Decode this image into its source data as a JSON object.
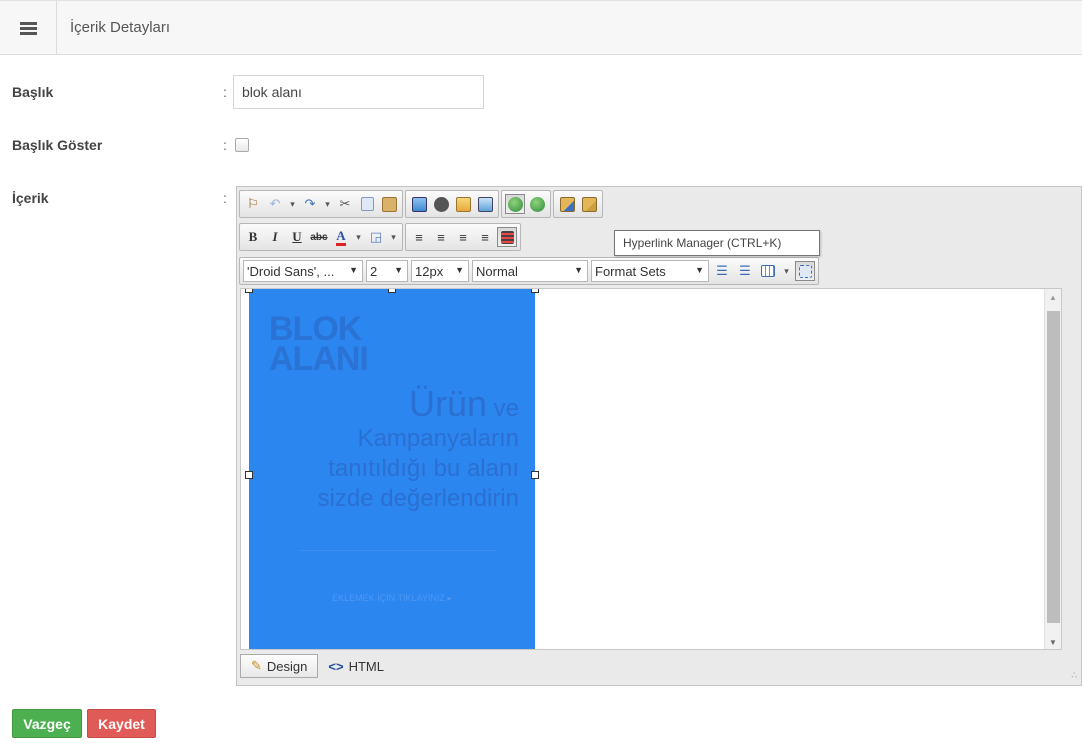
{
  "header": {
    "title": "İçerik Detayları",
    "menu_icon": "hamburger-icon"
  },
  "form": {
    "title_label": "Başlık",
    "title_value": "blok alanı",
    "show_title_label": "Başlık Göster",
    "show_title_checked": false,
    "content_label": "İçerik",
    "colon": ":"
  },
  "editor": {
    "format_bar": {
      "font_family": "'Droid Sans', ...",
      "font_size": "2",
      "pixel_size": "12px",
      "paragraph": "Normal",
      "format_sets": "Format Sets"
    },
    "tooltip": "Hyperlink Manager (CTRL+K)",
    "content_image": {
      "logo_line1": "BLOK",
      "logo_line2": "ALANI",
      "text_line1_big": "Ürün",
      "text_line1_small": " ve",
      "text_line2": "Kampanyaların",
      "text_line3": "tanıtıldığı bu alanı",
      "text_line4": "sizde değerlendirin",
      "cta": "EKLEMEK İÇİN TIKLAYINIZ ▸",
      "background_color": "#2b86f0"
    },
    "modes": {
      "design": "Design",
      "html": "HTML"
    }
  },
  "actions": {
    "cancel": "Vazgeç",
    "save": "Kaydet",
    "cancel_color": "#4caf50",
    "save_color": "#e05a57"
  }
}
